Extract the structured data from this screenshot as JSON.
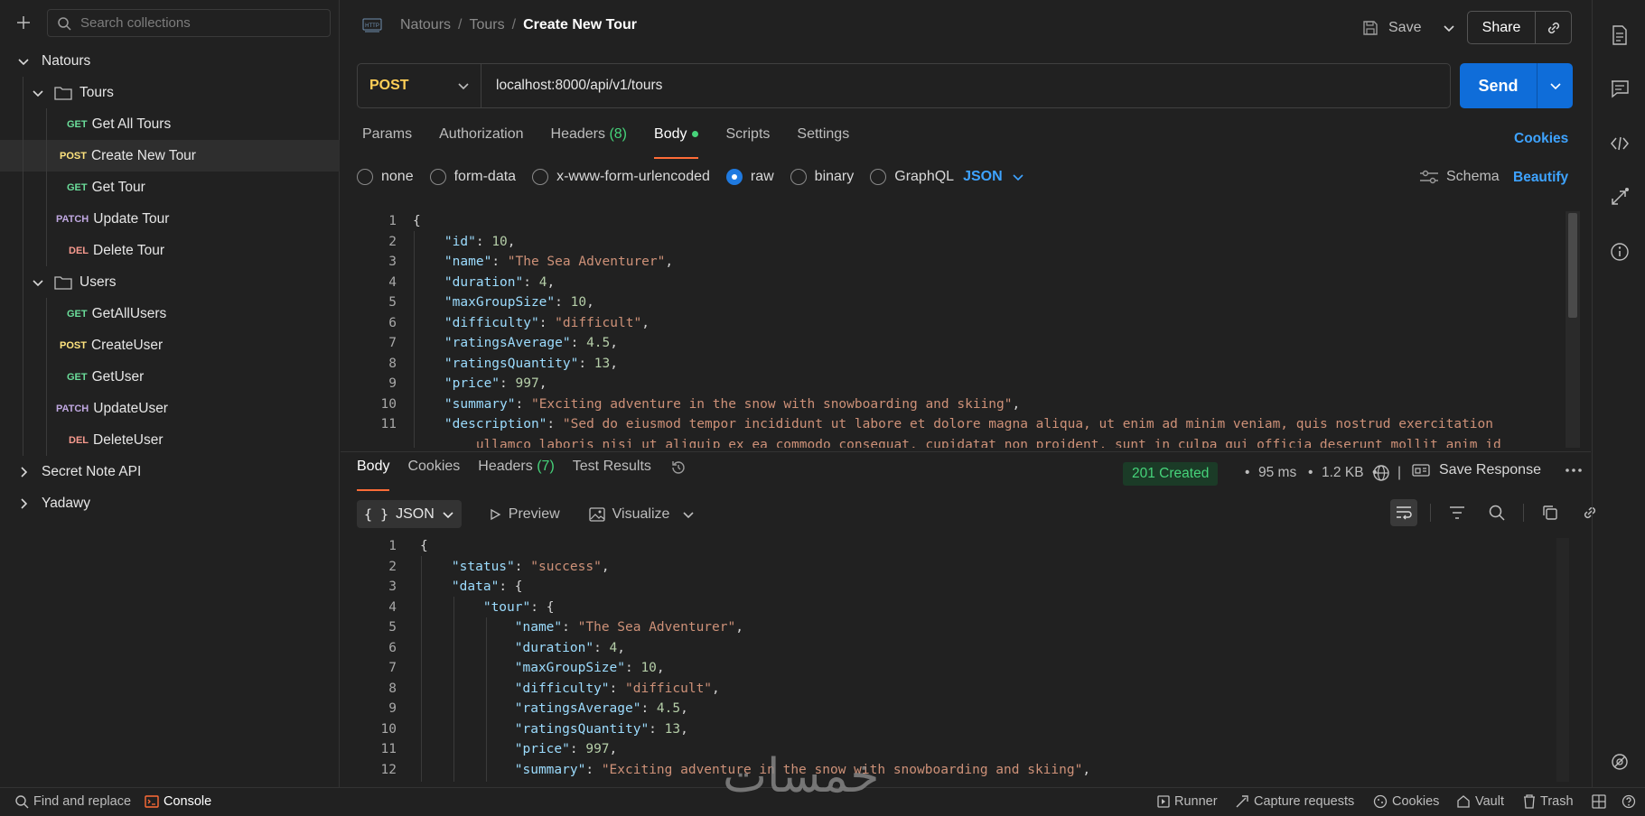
{
  "sidebar": {
    "search_placeholder": "Search collections",
    "tree": [
      {
        "type": "collection",
        "label": "Natours",
        "expanded": true
      },
      {
        "type": "folder",
        "label": "Tours",
        "expanded": true
      },
      {
        "type": "request",
        "method": "GET",
        "label": "Get All Tours"
      },
      {
        "type": "request",
        "method": "POST",
        "label": "Create New Tour",
        "selected": true
      },
      {
        "type": "request",
        "method": "GET",
        "label": "Get Tour"
      },
      {
        "type": "request",
        "method": "PATCH",
        "label": "Update Tour"
      },
      {
        "type": "request",
        "method": "DEL",
        "label": "Delete Tour"
      },
      {
        "type": "folder",
        "label": "Users",
        "expanded": true
      },
      {
        "type": "request",
        "method": "GET",
        "label": "GetAllUsers"
      },
      {
        "type": "request",
        "method": "POST",
        "label": "CreateUser"
      },
      {
        "type": "request",
        "method": "GET",
        "label": "GetUser"
      },
      {
        "type": "request",
        "method": "PATCH",
        "label": "UpdateUser"
      },
      {
        "type": "request",
        "method": "DEL",
        "label": "DeleteUser"
      },
      {
        "type": "collection",
        "label": "Secret Note API",
        "expanded": false
      },
      {
        "type": "collection",
        "label": "Yadawy",
        "expanded": false
      }
    ]
  },
  "header": {
    "breadcrumb": [
      "Natours",
      "Tours"
    ],
    "title": "Create New Tour",
    "save_label": "Save",
    "share_label": "Share"
  },
  "request": {
    "method": "POST",
    "url": "localhost:8000/api/v1/tours",
    "send_label": "Send",
    "tabs": [
      "Params",
      "Authorization",
      "Headers",
      "Body",
      "Scripts",
      "Settings"
    ],
    "headers_count": "(8)",
    "cookies_label": "Cookies",
    "body_modes": [
      "none",
      "form-data",
      "x-www-form-urlencoded",
      "raw",
      "binary",
      "GraphQL"
    ],
    "body_format": "JSON",
    "schema_label": "Schema",
    "beautify_label": "Beautify"
  },
  "request_body_lines": [
    [
      [
        "p",
        "{"
      ]
    ],
    [
      [
        "p",
        "    "
      ],
      [
        "k",
        "\"id\""
      ],
      [
        "p",
        ": "
      ],
      [
        "n",
        "10"
      ],
      [
        "p",
        ","
      ]
    ],
    [
      [
        "p",
        "    "
      ],
      [
        "k",
        "\"name\""
      ],
      [
        "p",
        ": "
      ],
      [
        "s",
        "\"The Sea Adventurer\""
      ],
      [
        "p",
        ","
      ]
    ],
    [
      [
        "p",
        "    "
      ],
      [
        "k",
        "\"duration\""
      ],
      [
        "p",
        ": "
      ],
      [
        "n",
        "4"
      ],
      [
        "p",
        ","
      ]
    ],
    [
      [
        "p",
        "    "
      ],
      [
        "k",
        "\"maxGroupSize\""
      ],
      [
        "p",
        ": "
      ],
      [
        "n",
        "10"
      ],
      [
        "p",
        ","
      ]
    ],
    [
      [
        "p",
        "    "
      ],
      [
        "k",
        "\"difficulty\""
      ],
      [
        "p",
        ": "
      ],
      [
        "s",
        "\"difficult\""
      ],
      [
        "p",
        ","
      ]
    ],
    [
      [
        "p",
        "    "
      ],
      [
        "k",
        "\"ratingsAverage\""
      ],
      [
        "p",
        ": "
      ],
      [
        "n",
        "4.5"
      ],
      [
        "p",
        ","
      ]
    ],
    [
      [
        "p",
        "    "
      ],
      [
        "k",
        "\"ratingsQuantity\""
      ],
      [
        "p",
        ": "
      ],
      [
        "n",
        "13"
      ],
      [
        "p",
        ","
      ]
    ],
    [
      [
        "p",
        "    "
      ],
      [
        "k",
        "\"price\""
      ],
      [
        "p",
        ": "
      ],
      [
        "n",
        "997"
      ],
      [
        "p",
        ","
      ]
    ],
    [
      [
        "p",
        "    "
      ],
      [
        "k",
        "\"summary\""
      ],
      [
        "p",
        ": "
      ],
      [
        "s",
        "\"Exciting adventure in the snow with snowboarding and skiing\""
      ],
      [
        "p",
        ","
      ]
    ],
    [
      [
        "p",
        "    "
      ],
      [
        "k",
        "\"description\""
      ],
      [
        "p",
        ": "
      ],
      [
        "s",
        "\"Sed do eiusmod tempor incididunt ut labore et dolore magna aliqua, ut enim ad minim veniam, quis nostrud exercitation"
      ]
    ],
    [
      [
        "s",
        "        ullamco laboris nisi ut aliquip ex ea commodo consequat. cupidatat non proident, sunt in culpa qui officia deserunt mollit anim id"
      ]
    ]
  ],
  "request_line_numbers": [
    "1",
    "2",
    "3",
    "4",
    "5",
    "6",
    "7",
    "8",
    "9",
    "10",
    "11",
    ""
  ],
  "response": {
    "tabs": [
      "Body",
      "Cookies",
      "Headers",
      "Test Results"
    ],
    "headers_count": "(7)",
    "status": "201 Created",
    "time": "95 ms",
    "size": "1.2 KB",
    "save_response_label": "Save Response",
    "format": "JSON",
    "preview_label": "Preview",
    "visualize_label": "Visualize"
  },
  "response_body_lines": [
    [
      [
        "p",
        "{"
      ]
    ],
    [
      [
        "p",
        "    "
      ],
      [
        "k",
        "\"status\""
      ],
      [
        "p",
        ": "
      ],
      [
        "s",
        "\"success\""
      ],
      [
        "p",
        ","
      ]
    ],
    [
      [
        "p",
        "    "
      ],
      [
        "k",
        "\"data\""
      ],
      [
        "p",
        ": {"
      ]
    ],
    [
      [
        "p",
        "        "
      ],
      [
        "k",
        "\"tour\""
      ],
      [
        "p",
        ": {"
      ]
    ],
    [
      [
        "p",
        "            "
      ],
      [
        "k",
        "\"name\""
      ],
      [
        "p",
        ": "
      ],
      [
        "s",
        "\"The Sea Adventurer\""
      ],
      [
        "p",
        ","
      ]
    ],
    [
      [
        "p",
        "            "
      ],
      [
        "k",
        "\"duration\""
      ],
      [
        "p",
        ": "
      ],
      [
        "n",
        "4"
      ],
      [
        "p",
        ","
      ]
    ],
    [
      [
        "p",
        "            "
      ],
      [
        "k",
        "\"maxGroupSize\""
      ],
      [
        "p",
        ": "
      ],
      [
        "n",
        "10"
      ],
      [
        "p",
        ","
      ]
    ],
    [
      [
        "p",
        "            "
      ],
      [
        "k",
        "\"difficulty\""
      ],
      [
        "p",
        ": "
      ],
      [
        "s",
        "\"difficult\""
      ],
      [
        "p",
        ","
      ]
    ],
    [
      [
        "p",
        "            "
      ],
      [
        "k",
        "\"ratingsAverage\""
      ],
      [
        "p",
        ": "
      ],
      [
        "n",
        "4.5"
      ],
      [
        "p",
        ","
      ]
    ],
    [
      [
        "p",
        "            "
      ],
      [
        "k",
        "\"ratingsQuantity\""
      ],
      [
        "p",
        ": "
      ],
      [
        "n",
        "13"
      ],
      [
        "p",
        ","
      ]
    ],
    [
      [
        "p",
        "            "
      ],
      [
        "k",
        "\"price\""
      ],
      [
        "p",
        ": "
      ],
      [
        "n",
        "997"
      ],
      [
        "p",
        ","
      ]
    ],
    [
      [
        "p",
        "            "
      ],
      [
        "k",
        "\"summary\""
      ],
      [
        "p",
        ": "
      ],
      [
        "s",
        "\"Exciting adventure in the snow with snowboarding and skiing\""
      ],
      [
        "p",
        ","
      ]
    ]
  ],
  "response_line_numbers": [
    "1",
    "2",
    "3",
    "4",
    "5",
    "6",
    "7",
    "8",
    "9",
    "10",
    "11",
    "12"
  ],
  "bottom_bar": {
    "find_replace": "Find and replace",
    "console": "Console",
    "runner": "Runner",
    "capture": "Capture requests",
    "cookies": "Cookies",
    "vault": "Vault",
    "trash": "Trash"
  },
  "watermark": "خمسات",
  "colors": {
    "accent": "#ff6c37",
    "send": "#0f6dd9",
    "link": "#3ea3ff",
    "success": "#46d37a"
  }
}
